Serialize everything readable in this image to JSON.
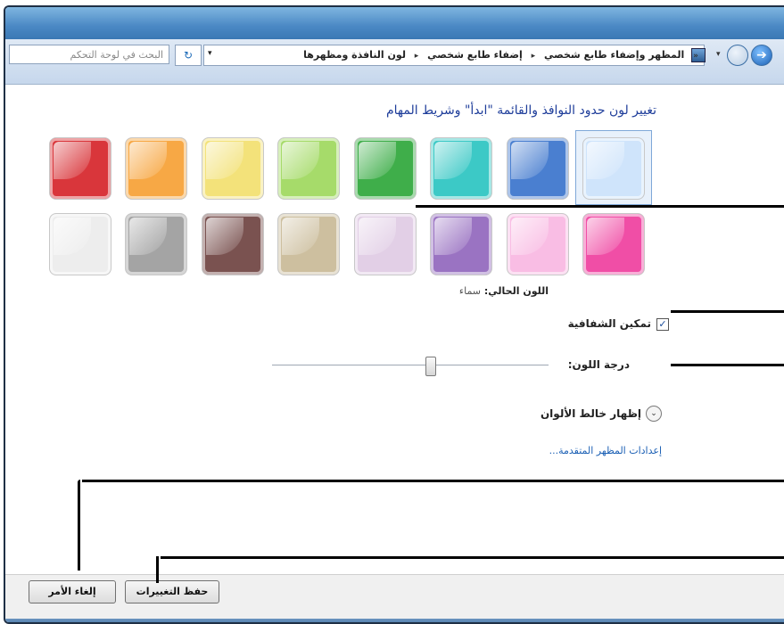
{
  "address_bar": {
    "breadcrumbs": [
      "المظهر وإضفاء طابع شخصي",
      "إضفاء طابع شخصي",
      "لون النافذة ومظهرها"
    ],
    "overflow": "«",
    "separator": "▸",
    "search_placeholder": "البحث في لوحة التحكم",
    "refresh_glyph": "↻"
  },
  "nav": {
    "back_glyph": "➔",
    "dropdown_glyph": "▾"
  },
  "main": {
    "heading": "تغيير لون حدود النوافذ والقائمة \"ابدأ\" وشريط المهام",
    "swatches_row1": [
      {
        "name": "sky",
        "color": "#cfe4fb"
      },
      {
        "name": "twilight",
        "color": "#4a7fd0"
      },
      {
        "name": "sea",
        "color": "#3cc9c6"
      },
      {
        "name": "leaf",
        "color": "#3fae4a"
      },
      {
        "name": "lime",
        "color": "#a6db6a"
      },
      {
        "name": "lemon",
        "color": "#f3e27a"
      },
      {
        "name": "orange",
        "color": "#f7a845"
      },
      {
        "name": "red",
        "color": "#d9363b"
      }
    ],
    "swatches_row2": [
      {
        "name": "fuchsia",
        "color": "#f04ea6"
      },
      {
        "name": "blush",
        "color": "#f9bde4"
      },
      {
        "name": "violet",
        "color": "#9a73c2"
      },
      {
        "name": "lavender",
        "color": "#e2cfe6"
      },
      {
        "name": "taupe",
        "color": "#cdbf9f"
      },
      {
        "name": "chocolate",
        "color": "#7a5250"
      },
      {
        "name": "slate",
        "color": "#a4a4a4"
      },
      {
        "name": "frost",
        "color": "#ededed"
      }
    ],
    "current_color_label": "اللون الحالي:",
    "current_color_value": "سماء",
    "transparency_label": "تمكين الشفافية",
    "transparency_checked": true,
    "check_glyph": "✓",
    "intensity_label": "درجة اللون:",
    "intensity_value": 0.57,
    "mixer_label": "إظهار خالط الألوان",
    "mixer_glyph": "⌄",
    "advanced_link": "إعدادات المظهر المتقدمة..."
  },
  "footer": {
    "save_label": "حفظ التغييرات",
    "cancel_label": "إلغاء الأمر"
  }
}
